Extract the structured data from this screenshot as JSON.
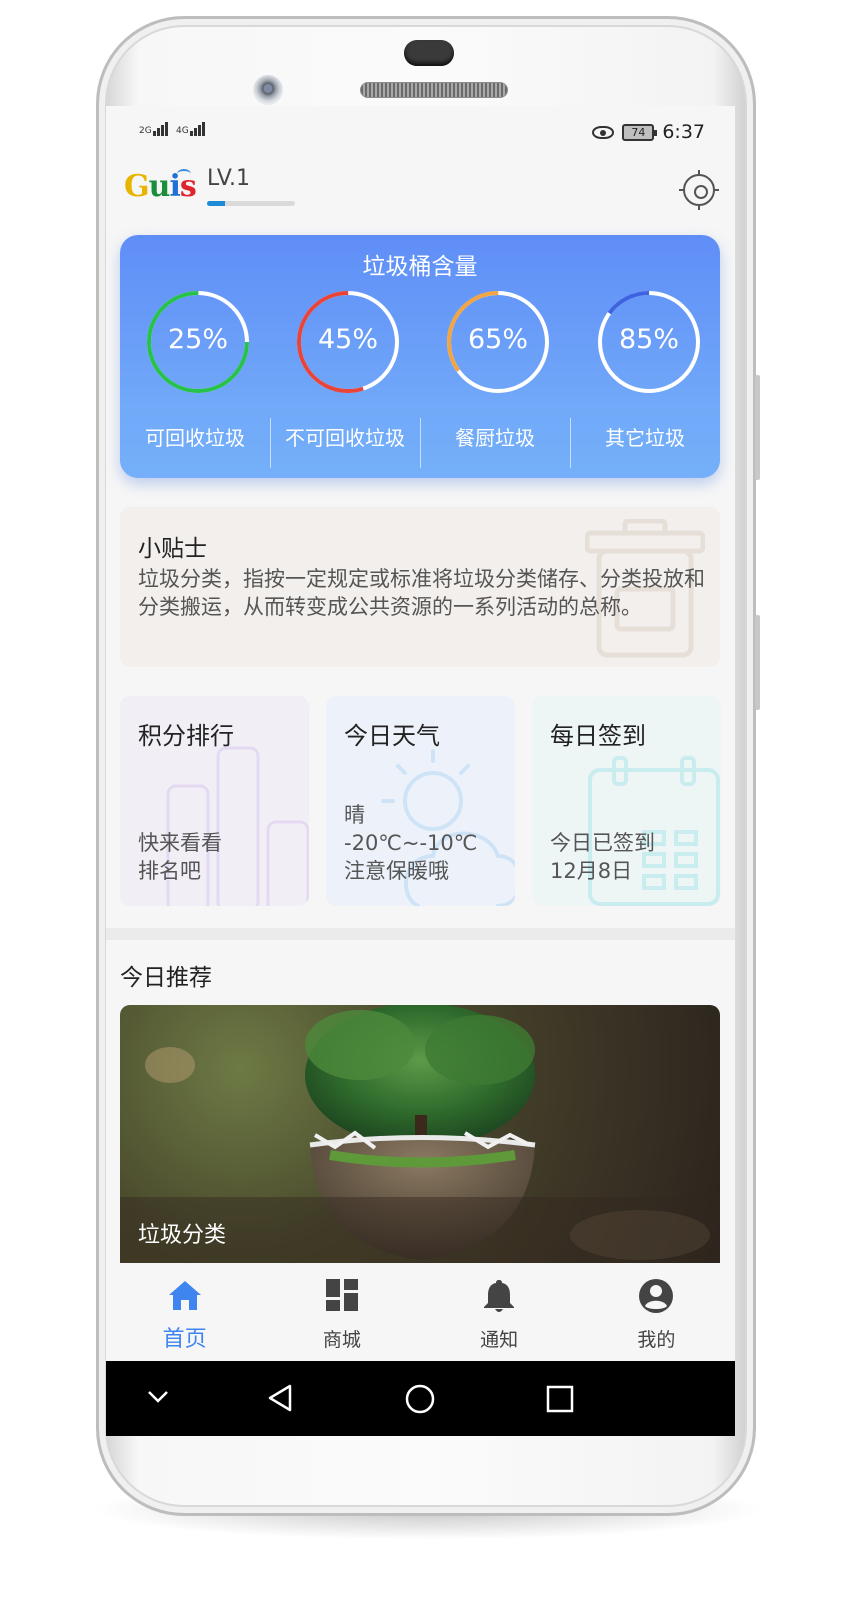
{
  "status_bar": {
    "signal_1": "2G",
    "signal_2": "4G",
    "battery": "74",
    "time": "6:37"
  },
  "app_bar": {
    "logo_text": "Guis",
    "level": "LV.1",
    "level_progress": 0.2
  },
  "bin_capacity": {
    "title": "垃圾桶含量",
    "gauges": [
      {
        "percent": "25%",
        "value": 25,
        "color": "#27c24c",
        "category": "可回收垃圾"
      },
      {
        "percent": "45%",
        "value": 45,
        "color": "#e8443a",
        "category": "不可回收垃圾"
      },
      {
        "percent": "65%",
        "value": 65,
        "color": "#f2a541",
        "category": "餐厨垃圾"
      },
      {
        "percent": "85%",
        "value": 85,
        "color": "#3d63e0",
        "category": "其它垃圾"
      }
    ]
  },
  "tips": {
    "title": "小贴士",
    "text": "垃圾分类，指按一定规定或标准将垃圾分类储存、分类投放和分类搬运，从而转变成公共资源的一系列活动的总称。"
  },
  "tiles": [
    {
      "title": "积分排行",
      "line1": "快来看看",
      "line2": "排名吧",
      "line3": "",
      "bg": "#f1eff5",
      "accent": "#e3d9f2"
    },
    {
      "title": "今日天气",
      "line1": "晴",
      "line2": "-20℃~-10℃",
      "line3": "注意保暖哦",
      "bg": "#edf2fa",
      "accent": "#cfe3f7"
    },
    {
      "title": "每日签到",
      "line1": "今日已签到",
      "line2": "12月8日",
      "line3": "",
      "bg": "#eef5f5",
      "accent": "#c9ecef"
    }
  ],
  "recommend": {
    "title": "今日推荐",
    "caption": "垃圾分类"
  },
  "bottom_nav": [
    {
      "label": "首页",
      "icon": "home-icon",
      "active": true
    },
    {
      "label": "商城",
      "icon": "dashboard-icon",
      "active": false
    },
    {
      "label": "通知",
      "icon": "bell-icon",
      "active": false
    },
    {
      "label": "我的",
      "icon": "account-icon",
      "active": false
    }
  ],
  "colors": {
    "accent": "#3f85f0",
    "card_gradient_top": "#5f8ef7"
  }
}
